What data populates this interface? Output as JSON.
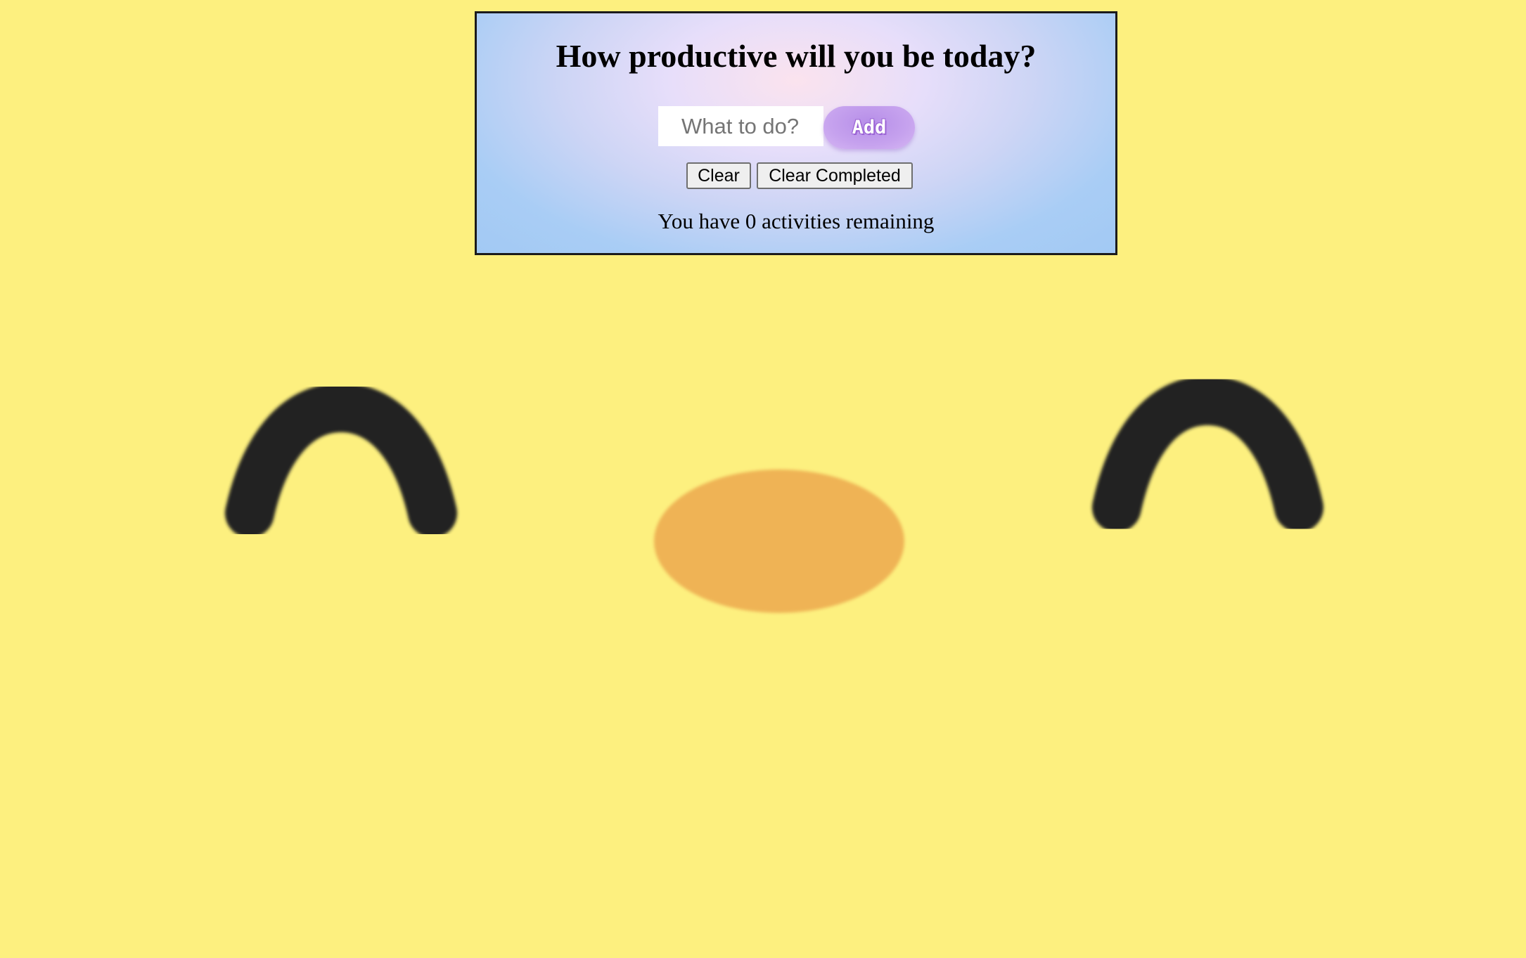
{
  "background": {
    "color": "#fdf07f",
    "eye_color": "#222222",
    "nose_color": "#efb355"
  },
  "todo": {
    "title": "How productive will you be today?",
    "input": {
      "value": "",
      "placeholder": "What to do?"
    },
    "add_label": "Add",
    "clear_label": "Clear",
    "clear_completed_label": "Clear Completed",
    "remaining_text": "You have 0 activities remaining"
  }
}
